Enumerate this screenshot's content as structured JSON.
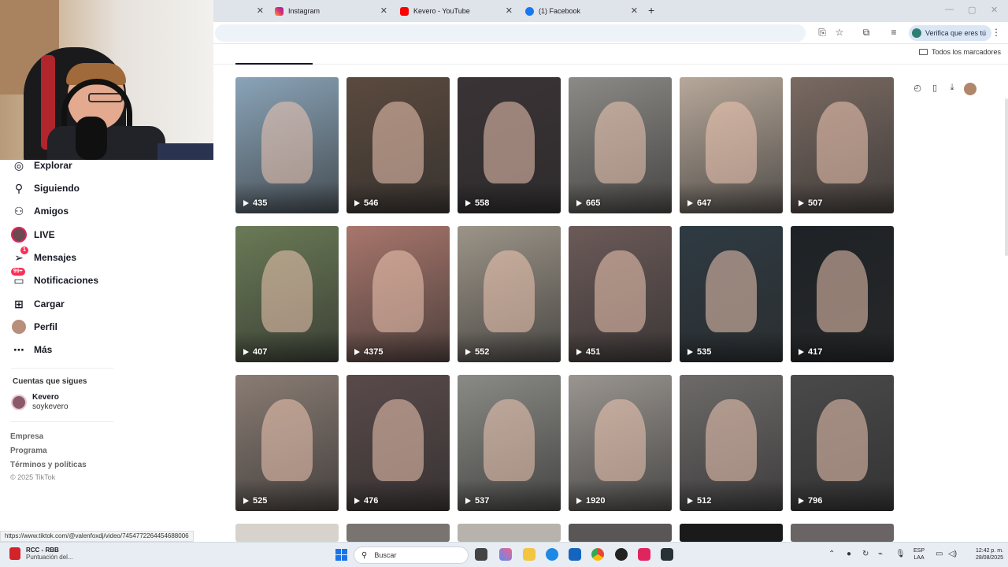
{
  "browser": {
    "tabs": [
      {
        "label": "",
        "icon": "blank-tab"
      },
      {
        "label": "Instagram",
        "icon": "instagram-icon",
        "color": "#e1306c"
      },
      {
        "label": "Kevero - YouTube",
        "icon": "youtube-icon",
        "color": "#ff0000"
      },
      {
        "label": "(1) Facebook",
        "icon": "facebook-icon",
        "color": "#1877f2"
      }
    ],
    "new_tab": "+",
    "verify_label": "Verifica que eres tú",
    "bookmarks_label": "Todos los marcadores"
  },
  "sidebar": {
    "items": [
      {
        "label": "Explorar",
        "icon": "compass-icon"
      },
      {
        "label": "Siguiendo",
        "icon": "following-icon"
      },
      {
        "label": "Amigos",
        "icon": "friends-icon"
      },
      {
        "label": "LIVE",
        "icon": "live-icon"
      },
      {
        "label": "Mensajes",
        "icon": "messages-icon",
        "badge": "1"
      },
      {
        "label": "Notificaciones",
        "icon": "bell-icon",
        "badge": "99+"
      },
      {
        "label": "Cargar",
        "icon": "upload-icon"
      },
      {
        "label": "Perfil",
        "icon": "profile-icon"
      },
      {
        "label": "Más",
        "icon": "more-icon"
      }
    ],
    "following_title": "Cuentas que sigues",
    "following": {
      "name": "Kevero",
      "handle": "soykevero"
    },
    "footer": [
      "Empresa",
      "Programa",
      "Términos y políticas"
    ],
    "copyright": "© 2025 TikTok"
  },
  "videos": [
    {
      "views": "435",
      "color": "#8aa4b8"
    },
    {
      "views": "546",
      "color": "#5b4a3e"
    },
    {
      "views": "558",
      "color": "#3a3336"
    },
    {
      "views": "665",
      "color": "#8c8a86"
    },
    {
      "views": "647",
      "color": "#b7a89a"
    },
    {
      "views": "507",
      "color": "#7a6a62"
    },
    {
      "views": "407",
      "color": "#6a7a56"
    },
    {
      "views": "4375",
      "color": "#a8766c"
    },
    {
      "views": "552",
      "color": "#9c9488"
    },
    {
      "views": "451",
      "color": "#6b5a58"
    },
    {
      "views": "535",
      "color": "#2e3a42"
    },
    {
      "views": "417",
      "color": "#1e2226"
    },
    {
      "views": "525",
      "color": "#8a7c74"
    },
    {
      "views": "476",
      "color": "#5a4a4a"
    },
    {
      "views": "537",
      "color": "#8a8a86"
    },
    {
      "views": "1920",
      "color": "#9a9590"
    },
    {
      "views": "512",
      "color": "#6e6a6a"
    },
    {
      "views": "796",
      "color": "#4a4a4a"
    }
  ],
  "status_url": "https://www.tiktok.com/@valenfoxdj/video/7454772264454688006",
  "taskbar": {
    "app_title": "RCC - RBB",
    "app_subtitle": "Puntuación del...",
    "search_placeholder": "Buscar",
    "lang_top": "ESP",
    "lang_bottom": "LAA",
    "time": "12:42 p. m.",
    "date": "28/08/2025"
  }
}
